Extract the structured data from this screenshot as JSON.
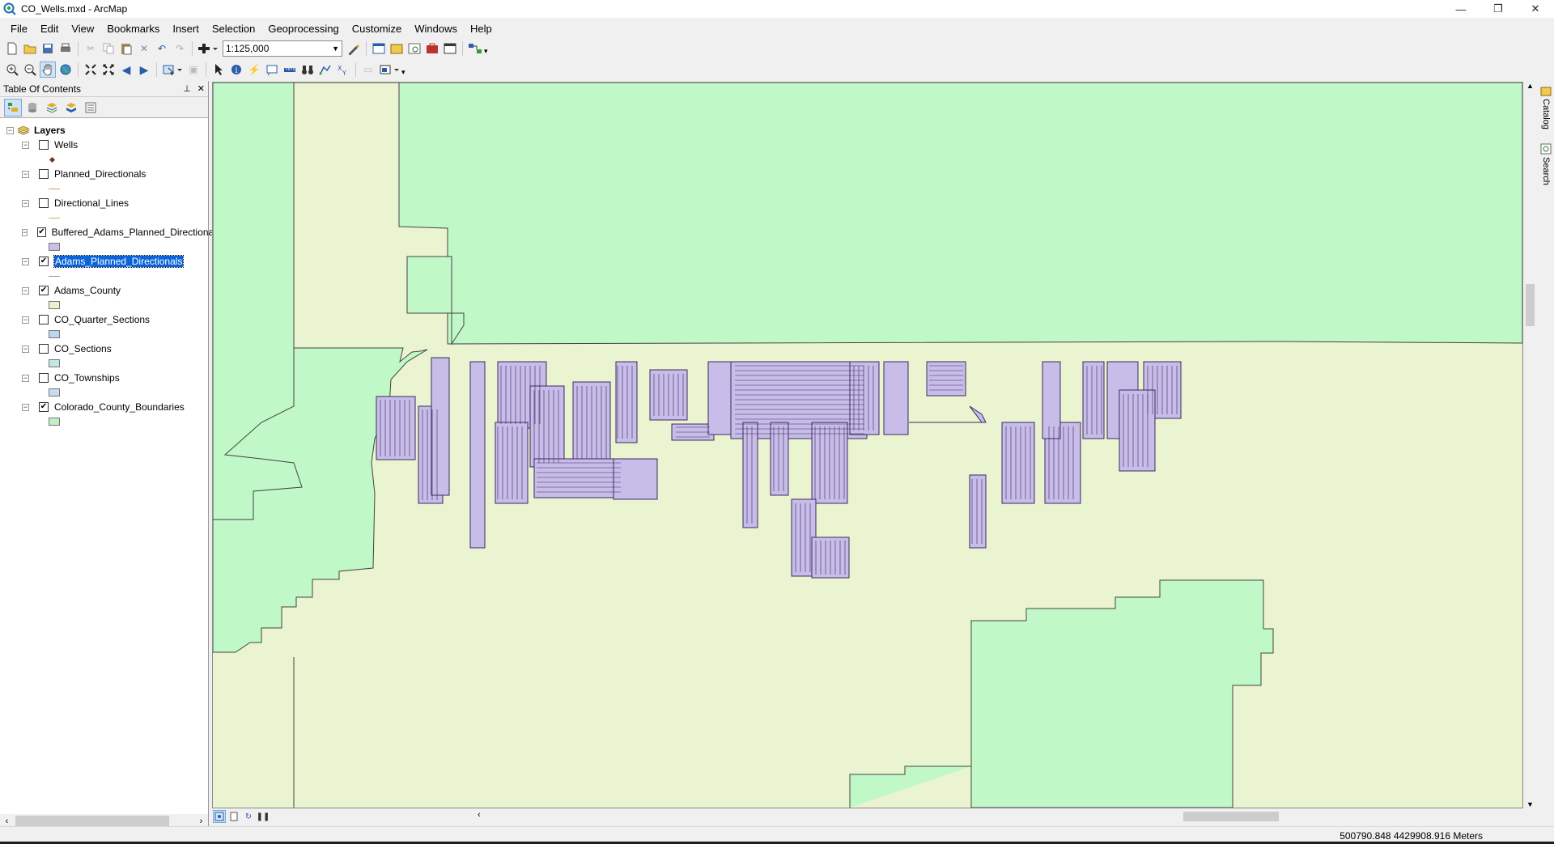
{
  "window": {
    "title": "CO_Wells.mxd - ArcMap",
    "controls": [
      "—",
      "❐",
      "✕"
    ]
  },
  "menu": [
    "File",
    "Edit",
    "View",
    "Bookmarks",
    "Insert",
    "Selection",
    "Geoprocessing",
    "Customize",
    "Windows",
    "Help"
  ],
  "toolbar": {
    "scale": "1:125,000"
  },
  "toc": {
    "title": "Table Of Contents",
    "root_label": "Layers",
    "layers": [
      {
        "name": "Wells",
        "checked": false,
        "symbol": "point",
        "color": "#6b3a1a"
      },
      {
        "name": "Planned_Directionals",
        "checked": false,
        "symbol": "line",
        "color": "#c8a060"
      },
      {
        "name": "Directional_Lines",
        "checked": false,
        "symbol": "line",
        "color": "#c8b060"
      },
      {
        "name": "Buffered_Adams_Planned_Directionals",
        "checked": true,
        "symbol": "fill",
        "color": "#cbbfe8"
      },
      {
        "name": "Adams_Planned_Directionals",
        "checked": true,
        "symbol": "line",
        "color": "#7fae7f",
        "selected": true
      },
      {
        "name": "Adams_County",
        "checked": true,
        "symbol": "fill",
        "color": "#e9f4cd"
      },
      {
        "name": "CO_Quarter_Sections",
        "checked": false,
        "symbol": "fill",
        "color": "#bfd4f0"
      },
      {
        "name": "CO_Sections",
        "checked": false,
        "symbol": "fill",
        "color": "#bfe8e0"
      },
      {
        "name": "CO_Townships",
        "checked": false,
        "symbol": "fill",
        "color": "#c8dcf0"
      },
      {
        "name": "Colorado_County_Boundaries",
        "checked": true,
        "symbol": "fill",
        "color": "#bff0c4"
      }
    ]
  },
  "dock": {
    "catalog": "Catalog",
    "search": "Search"
  },
  "status": {
    "coordinates": "500790.848  4429908.916 Meters"
  },
  "colors": {
    "county_fill": "#c0f8c8",
    "adams_fill": "#eaf4d0",
    "buffer_fill": "#c8bce8",
    "selection": "#0a64d8"
  }
}
